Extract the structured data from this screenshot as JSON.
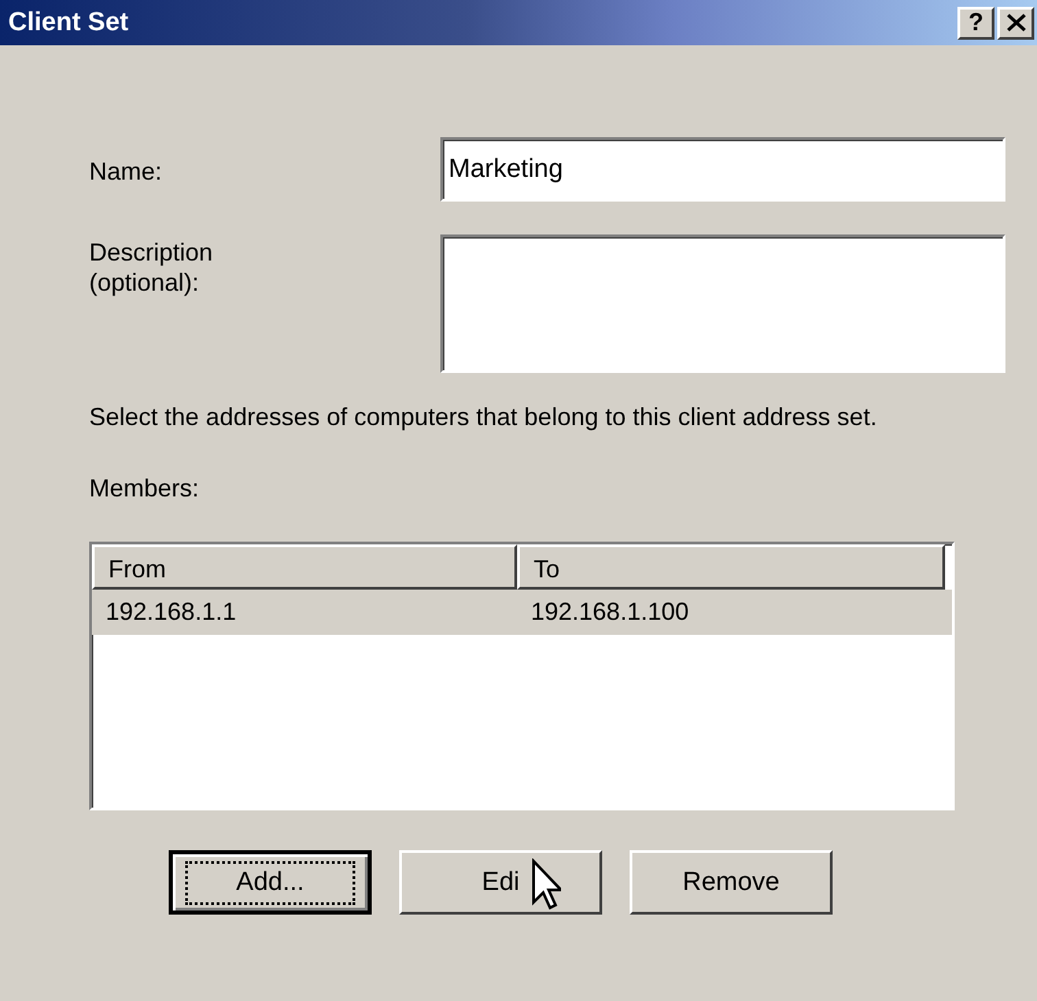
{
  "window": {
    "title": "Client Set",
    "help_button": "?"
  },
  "name_field": {
    "label": "Name:",
    "value": "Marketing"
  },
  "description_field": {
    "label": "Description\n(optional):"
  },
  "instructions": "Select the addresses of computers that belong to this client address set.",
  "members_label": "Members:",
  "table": {
    "columns": [
      "From",
      "To"
    ],
    "rows": [
      {
        "cells": [
          "192.168.1.1",
          "192.168.1.100"
        ],
        "selected": true
      }
    ]
  },
  "buttons": [
    {
      "label": "Add...",
      "focused": true
    },
    {
      "label": "Edi",
      "focused": false,
      "cursor_over": true
    },
    {
      "label": "Remove",
      "focused": false
    }
  ]
}
